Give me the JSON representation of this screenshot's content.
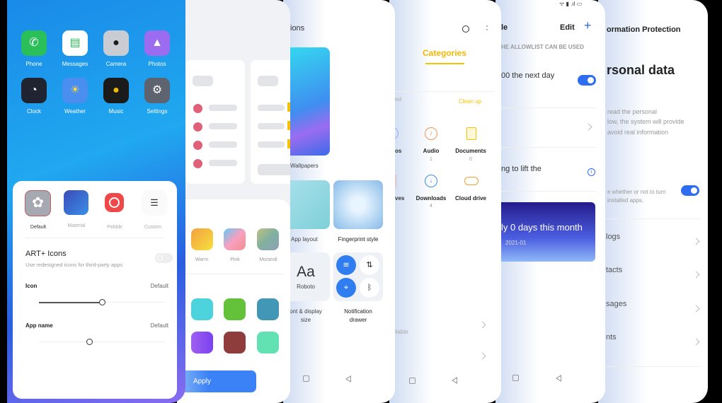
{
  "home": {
    "apps": [
      {
        "label": "Phone",
        "color": "#2bbf5a"
      },
      {
        "label": "Messages",
        "color": "#ffffff"
      },
      {
        "label": "Camera",
        "color": "#c9cdd3"
      },
      {
        "label": "Photos",
        "color": "#9b6cf0"
      },
      {
        "label": "Clock",
        "color": "#1f2430"
      },
      {
        "label": "Weather",
        "color": "#4a8ff0"
      },
      {
        "label": "Music",
        "color": "#1b1b1b"
      },
      {
        "label": "Settings",
        "color": "#5d6470"
      }
    ],
    "icon_styles": [
      {
        "label": "Default"
      },
      {
        "label": "Material"
      },
      {
        "label": "Pebble"
      },
      {
        "label": "Custom"
      }
    ],
    "art_title": "ART+ Icons",
    "art_desc": "Use redesigned icons for third-party apps",
    "art_enabled": false,
    "icon_label": "Icon",
    "icon_value": "Default",
    "icon_slider": 0.5,
    "appname_label": "App name",
    "appname_value": "Default",
    "appname_slider": 0.4
  },
  "theme": {
    "gradients": [
      {
        "label": "Warm"
      },
      {
        "label": "Pink"
      },
      {
        "label": "Morandi"
      }
    ],
    "colors": [
      "#4cd3dc",
      "#63c13a",
      "#4197b5",
      "#8e5cf0",
      "#8e3c3c",
      "#62e2b2"
    ],
    "apply": "Apply"
  },
  "personalize": {
    "title": "ions",
    "wallpapers": "Wallpapers",
    "app_layout": "App layout",
    "fingerprint": "Fingerprint style",
    "font_sample": "Aa",
    "font_name": "Roboto",
    "font_label1": "ont & display",
    "font_label2": "size",
    "notif_label1": "Notification",
    "notif_label2": "drawer"
  },
  "files": {
    "tab": "Categories",
    "used": "ed",
    "clean": "Clean up",
    "cats": [
      {
        "label": "os"
      },
      {
        "label": "Audio",
        "count": "1"
      },
      {
        "label": "Documents",
        "count": "0"
      },
      {
        "label": "ves"
      },
      {
        "label": "Downloads",
        "count": "4"
      },
      {
        "label": "Cloud drive"
      }
    ],
    "available": "llable"
  },
  "allow": {
    "title": "le",
    "edit": "Edit",
    "add": "+",
    "header": "HE ALLOWLIST CAN BE USED",
    "next_day": "00 the next day",
    "next_day_on": true,
    "lift": "ng to lift the",
    "banner": "ly 0 days this month",
    "banner_date": "2021-01"
  },
  "privacy": {
    "title": "ormation Protection",
    "heading": "rsonal data",
    "desc": [
      "read the personal",
      "low, the system will provide",
      "avoid real information"
    ],
    "toggle_desc": [
      "e whether or not to turn",
      "installed apps."
    ],
    "toggle_on": true,
    "items": [
      "logs",
      "tacts",
      "sages",
      "nts"
    ]
  }
}
